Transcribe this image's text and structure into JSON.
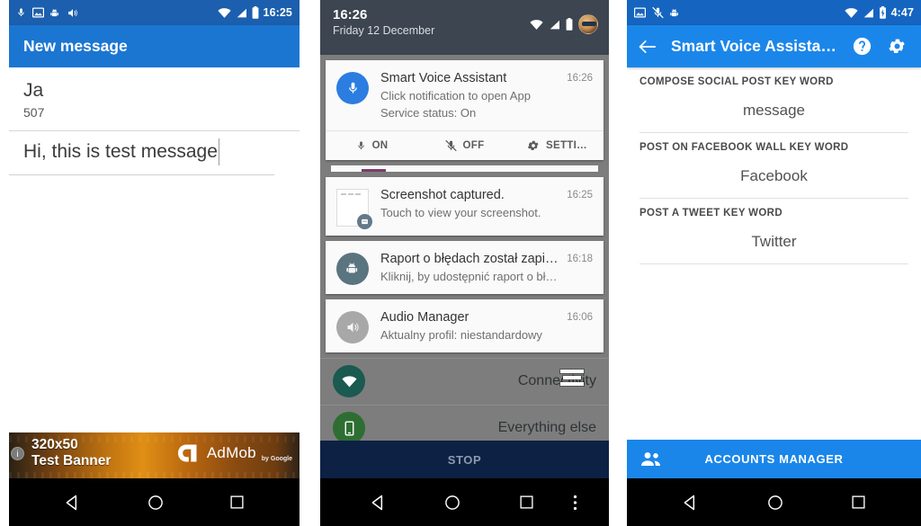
{
  "panel1": {
    "statusbar": {
      "icons": [
        "mic-icon",
        "image-icon",
        "android-bug-icon",
        "volume-icon"
      ],
      "right_icons": [
        "wifi-icon",
        "signal-icon",
        "battery-icon"
      ],
      "time": "16:25"
    },
    "appbar": {
      "title": "New message"
    },
    "recipient": {
      "name": "Ja",
      "number": "507"
    },
    "message": {
      "value": "Hi, this is test message"
    },
    "ad": {
      "info_glyph": "i",
      "line1": "320x50",
      "line2": "Test Banner",
      "brand": "AdMob",
      "brand_sub": "by Google"
    },
    "nav": {
      "back": "back-icon",
      "home": "home-icon",
      "recents": "recents-icon"
    }
  },
  "panel2": {
    "statusbar": {
      "time": "16:26",
      "date": "Friday 12 December",
      "right_icons": [
        "wifi-icon",
        "signal-icon",
        "battery-icon",
        "avatar"
      ]
    },
    "notifications": [
      {
        "icon": "mic-icon",
        "title": "Smart Voice Assistant",
        "line1": "Click notification to open App",
        "line2": "Service status: On",
        "time": "16:26",
        "actions": [
          {
            "icon": "mic-icon",
            "label": "ON"
          },
          {
            "icon": "mic-off-icon",
            "label": "OFF"
          },
          {
            "icon": "gear-icon",
            "label": "SETTI…"
          }
        ]
      },
      {
        "icon": "screenshot-thumb",
        "title": "Screenshot captured.",
        "line1": "Touch to view your screenshot.",
        "time": "16:25"
      },
      {
        "icon": "android-bug-icon",
        "title": "Raport o błędach został zapisa…",
        "line1": "Kliknij, by udostępnić raport o błędach",
        "time": "16:18"
      },
      {
        "icon": "volume-icon",
        "title": "Audio Manager",
        "line1": "Aktualny profil: niestandardowy",
        "time": "16:06"
      }
    ],
    "quick_rows": [
      {
        "icon": "wifi-filled-icon",
        "label": "Connectivity"
      },
      {
        "icon": "phone-icon",
        "label": "Everything else"
      }
    ],
    "stop_button": {
      "label": "STOP"
    },
    "nav": {
      "back": "back-icon",
      "home": "home-icon",
      "recents": "recents-icon",
      "more": "overflow-icon"
    }
  },
  "panel3": {
    "statusbar": {
      "icons": [
        "image-icon",
        "mic-off-icon",
        "android-bug-icon"
      ],
      "right_icons": [
        "wifi-icon",
        "signal-icon",
        "battery-charging-icon"
      ],
      "time": "4:47"
    },
    "appbar": {
      "back": "arrow-back-icon",
      "title": "Smart Voice Assista…",
      "help": "help-icon",
      "settings": "gear-icon"
    },
    "preferences": [
      {
        "header": "COMPOSE SOCIAL POST KEY WORD",
        "value": "message"
      },
      {
        "header": "POST ON FACEBOOK WALL KEY WORD",
        "value": "Facebook"
      },
      {
        "header": "POST A TWEET KEY WORD",
        "value": "Twitter"
      }
    ],
    "accounts_button": {
      "icon": "people-icon",
      "label": "ACCOUNTS MANAGER"
    },
    "nav": {
      "back": "back-icon",
      "home": "home-icon",
      "recents": "recents-icon"
    }
  },
  "colors": {
    "appbar_blue": "#1b76d2",
    "appbar_blue_light": "#1b86ea",
    "statusbar_blue": "#1b5fae",
    "shade_grey": "#7d7d7d",
    "shade_header": "#3c4550",
    "stop_navy": "#0d2144"
  }
}
